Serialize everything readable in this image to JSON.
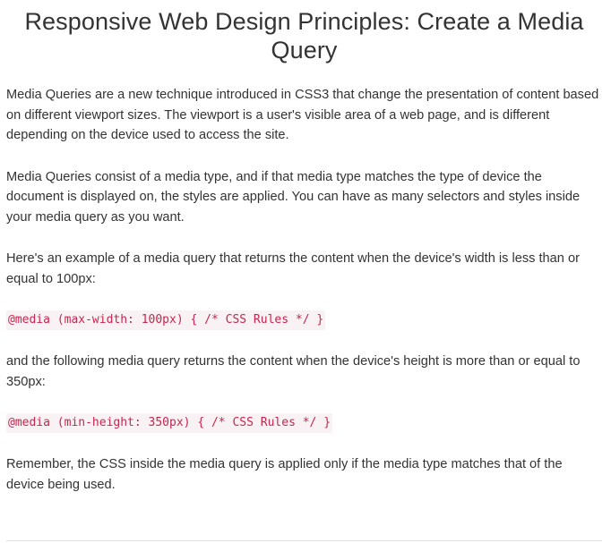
{
  "page": {
    "title": "Responsive Web Design Principles: Create a Media Query",
    "paragraphs": [
      "Media Queries are a new technique introduced in CSS3 that change the presentation of content based on different viewport sizes. The viewport is a user's visible area of a web page, and is different depending on the device used to access the site.",
      "Media Queries consist of a media type, and if that media type matches the type of device the document is displayed on, the styles are applied. You can have as many selectors and styles inside your media query as you want.",
      "Here's an example of a media query that returns the content when the device's width is less than or equal to 100px:",
      "and the following media query returns the content when the device's height is more than or equal to 350px:",
      "Remember, the CSS inside the media query is applied only if the media type matches that of the device being used."
    ],
    "code_examples": [
      "@media (max-width: 100px) { /* CSS Rules */ }",
      "@media (min-height: 350px) { /* CSS Rules */ }"
    ]
  },
  "colors": {
    "text": "#333333",
    "code_text": "#c7254e",
    "code_background": "#f9f2f4",
    "divider": "#dddddd"
  }
}
